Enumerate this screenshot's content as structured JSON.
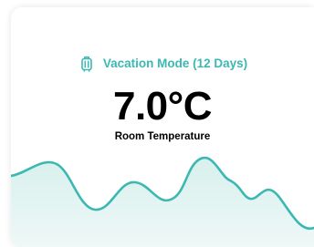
{
  "card": {
    "mode_label": "Vacation Mode (12 Days)",
    "mode_icon": "luggage-icon",
    "temperature": "7.0°C",
    "temperature_label": "Room Temperature"
  },
  "colors": {
    "accent": "#3cb8b2",
    "wave_fill": "#e2f4f2",
    "text": "#000000"
  }
}
